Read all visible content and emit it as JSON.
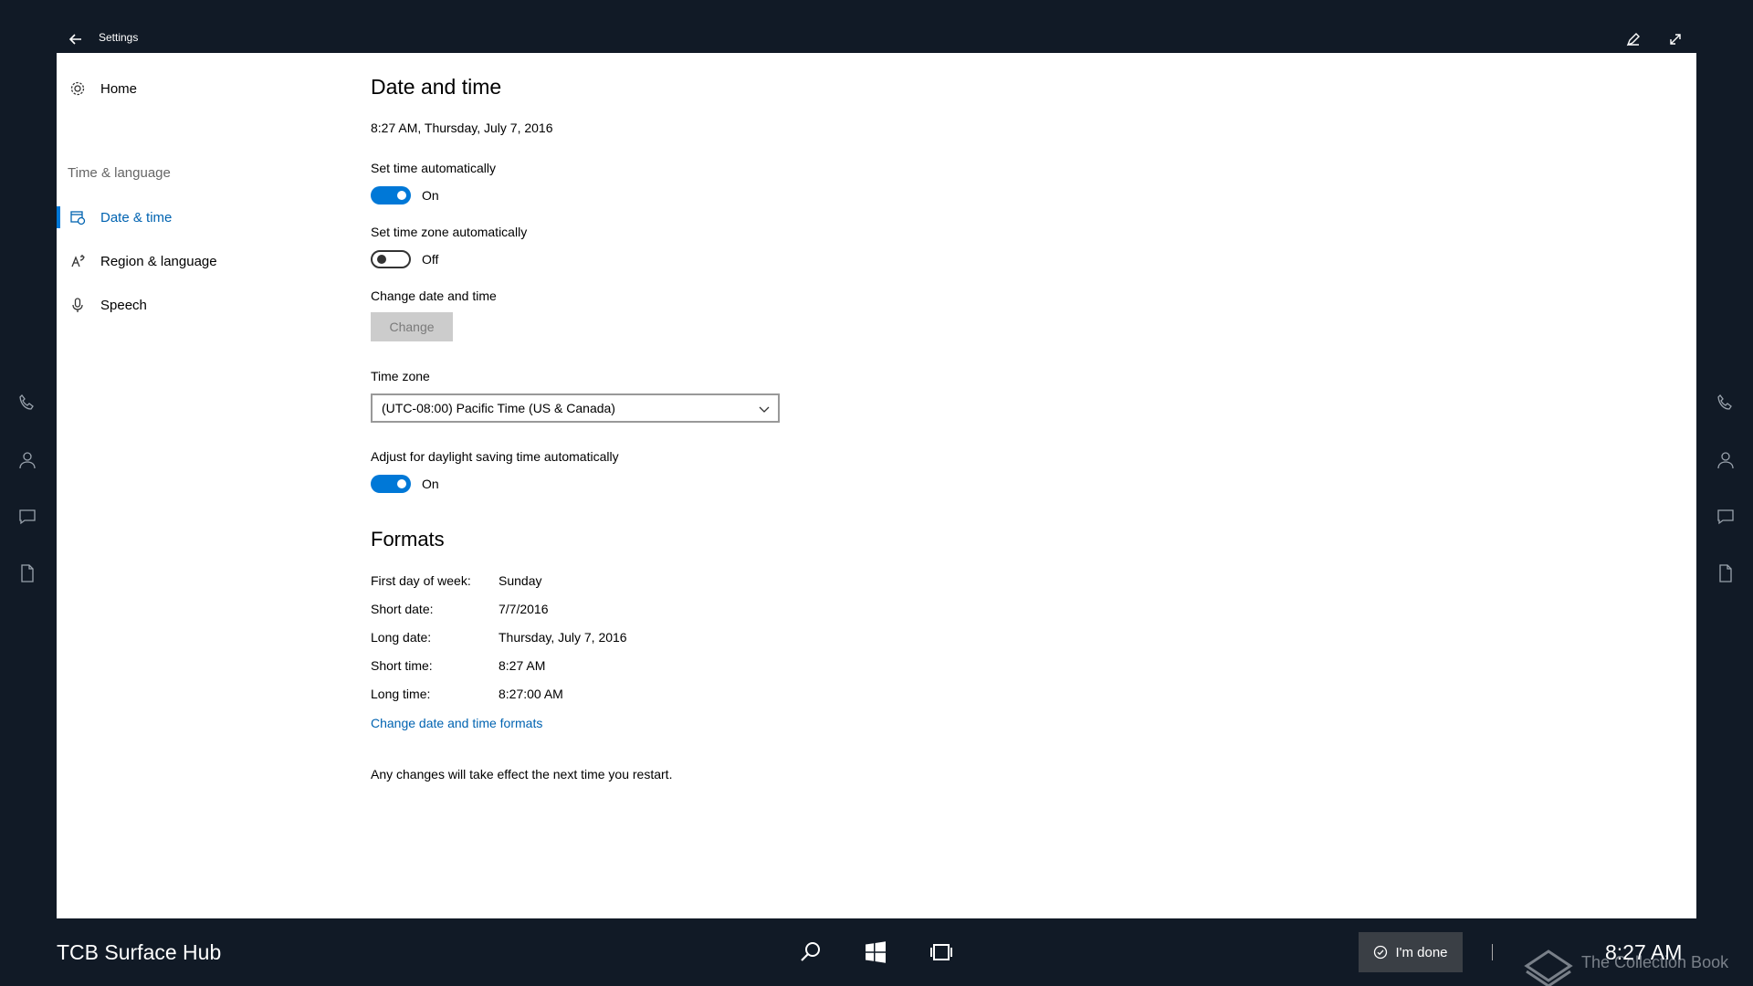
{
  "titlebar": {
    "title": "Settings"
  },
  "nav": {
    "home": "Home",
    "group": "Time & language",
    "items": [
      {
        "label": "Date & time"
      },
      {
        "label": "Region & language"
      },
      {
        "label": "Speech"
      }
    ]
  },
  "main": {
    "title": "Date and time",
    "current_datetime": "8:27 AM, Thursday, July 7, 2016",
    "set_time_auto": {
      "label": "Set time automatically",
      "state": "On"
    },
    "set_tz_auto": {
      "label": "Set time zone automatically",
      "state": "Off"
    },
    "change_dt": {
      "label": "Change date and time",
      "button": "Change"
    },
    "timezone": {
      "label": "Time zone",
      "value": "(UTC-08:00) Pacific Time (US & Canada)"
    },
    "dst": {
      "label": "Adjust for daylight saving time automatically",
      "state": "On"
    },
    "formats": {
      "title": "Formats",
      "rows": [
        {
          "label": "First day of week:",
          "value": "Sunday"
        },
        {
          "label": "Short date:",
          "value": "7/7/2016"
        },
        {
          "label": "Long date:",
          "value": "Thursday, July 7, 2016"
        },
        {
          "label": "Short time:",
          "value": "8:27 AM"
        },
        {
          "label": "Long time:",
          "value": "8:27:00 AM"
        }
      ],
      "link": "Change date and time formats"
    },
    "note": "Any changes will take effect the next time you restart."
  },
  "taskbar": {
    "device_name": "TCB Surface Hub",
    "done": "I'm done",
    "clock": "8:27 AM"
  },
  "watermark": "The Collection Book",
  "colors": {
    "accent": "#0078d7",
    "link": "#0063b1",
    "background": "#111a26"
  }
}
